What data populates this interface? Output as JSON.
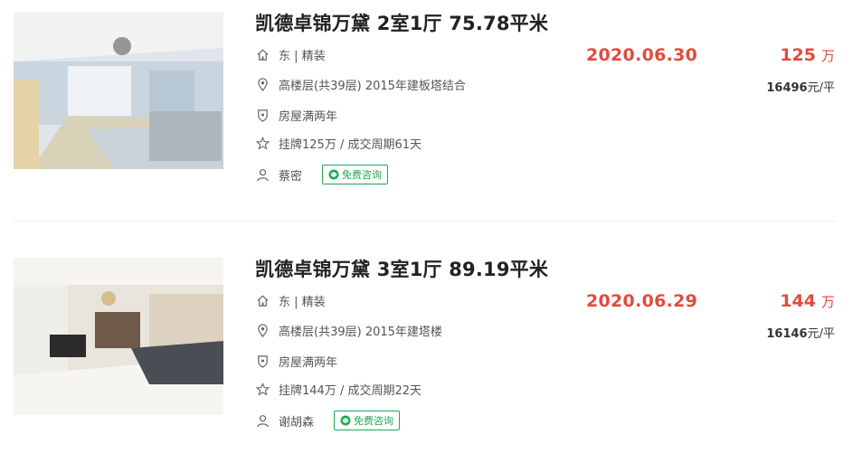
{
  "listings": [
    {
      "title": "凯德卓锦万黛 2室1厅 75.78平米",
      "house_info": "东 | 精装",
      "position_info": "高楼层(共39层) 2015年建板塔结合",
      "tag": "房屋满两年",
      "deal_cycle": "挂牌125万 / 成交周期61天",
      "agent": "蔡密",
      "consult_label": "免费咨询",
      "deal_date": "2020.06.30",
      "total_price": "125",
      "total_price_unit": "万",
      "unit_price_value": "16496",
      "unit_price_suffix": "元/平"
    },
    {
      "title": "凯德卓锦万黛 3室1厅 89.19平米",
      "house_info": "东 | 精装",
      "position_info": "高楼层(共39层) 2015年建塔楼",
      "tag": "房屋满两年",
      "deal_cycle": "挂牌144万 / 成交周期22天",
      "agent": "谢胡森",
      "consult_label": "免费咨询",
      "deal_date": "2020.06.29",
      "total_price": "144",
      "total_price_unit": "万",
      "unit_price_value": "16146",
      "unit_price_suffix": "元/平"
    }
  ],
  "icons": {
    "house": "house-icon",
    "location": "location-pin-icon",
    "tag": "shield-icon",
    "deal": "star-icon",
    "agent": "person-icon",
    "consult": "wechat-icon"
  },
  "colors": {
    "price_red": "#e24b3c",
    "consult_green": "#1fa857"
  }
}
